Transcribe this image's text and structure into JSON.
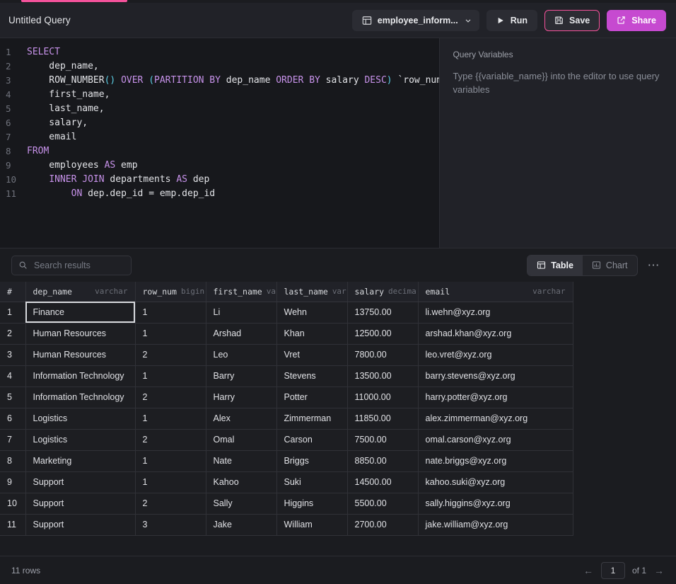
{
  "header": {
    "query_title": "Untitled Query",
    "db_selector_label": "employee_inform...",
    "db_icon": "database-table-icon",
    "chevron_icon": "chevron-down-icon",
    "run_label": "Run",
    "run_icon": "play-icon",
    "save_label": "Save",
    "save_icon": "floppy-disk-icon",
    "share_label": "Share",
    "share_icon": "external-link-icon"
  },
  "editor": {
    "lines": [
      {
        "n": "1",
        "tokens": [
          {
            "t": "SELECT",
            "c": "kw"
          }
        ]
      },
      {
        "n": "2",
        "tokens": [
          {
            "t": "    dep_name,",
            "c": "plain"
          }
        ]
      },
      {
        "n": "3",
        "tokens": [
          {
            "t": "    ROW_NUMBER",
            "c": "plain"
          },
          {
            "t": "()",
            "c": "paren-blue"
          },
          {
            "t": " ",
            "c": "plain"
          },
          {
            "t": "OVER",
            "c": "kw"
          },
          {
            "t": " ",
            "c": "plain"
          },
          {
            "t": "(",
            "c": "paren-blue"
          },
          {
            "t": "PARTITION BY",
            "c": "kw"
          },
          {
            "t": " dep_name ",
            "c": "plain"
          },
          {
            "t": "ORDER BY",
            "c": "kw"
          },
          {
            "t": " salary ",
            "c": "plain"
          },
          {
            "t": "DESC",
            "c": "kw"
          },
          {
            "t": ")",
            "c": "paren-blue"
          },
          {
            "t": " `row_num`,",
            "c": "plain"
          }
        ]
      },
      {
        "n": "4",
        "tokens": [
          {
            "t": "    first_name,",
            "c": "plain"
          }
        ]
      },
      {
        "n": "5",
        "tokens": [
          {
            "t": "    last_name,",
            "c": "plain"
          }
        ]
      },
      {
        "n": "6",
        "tokens": [
          {
            "t": "    salary,",
            "c": "plain"
          }
        ]
      },
      {
        "n": "7",
        "tokens": [
          {
            "t": "    email",
            "c": "plain"
          }
        ]
      },
      {
        "n": "8",
        "tokens": [
          {
            "t": "FROM",
            "c": "kw"
          }
        ]
      },
      {
        "n": "9",
        "tokens": [
          {
            "t": "    employees ",
            "c": "plain"
          },
          {
            "t": "AS",
            "c": "kw"
          },
          {
            "t": " emp",
            "c": "plain"
          }
        ]
      },
      {
        "n": "10",
        "tokens": [
          {
            "t": "    ",
            "c": "plain"
          },
          {
            "t": "INNER JOIN",
            "c": "kw"
          },
          {
            "t": " departments ",
            "c": "plain"
          },
          {
            "t": "AS",
            "c": "kw"
          },
          {
            "t": " dep",
            "c": "plain"
          }
        ]
      },
      {
        "n": "11",
        "tokens": [
          {
            "t": "        ",
            "c": "plain"
          },
          {
            "t": "ON",
            "c": "kw"
          },
          {
            "t": " dep.dep_id = emp.dep_id",
            "c": "plain"
          }
        ]
      }
    ]
  },
  "variables_panel": {
    "title": "Query Variables",
    "hint": "Type {{variable_name}} into the editor to use query variables"
  },
  "results_toolbar": {
    "search_placeholder": "Search results",
    "search_value": "",
    "search_icon": "search-icon",
    "table_label": "Table",
    "table_icon": "table-icon",
    "chart_label": "Chart",
    "chart_icon": "bar-chart-icon",
    "active_view": "Table",
    "more_icon": "more-horizontal-icon"
  },
  "results_table": {
    "index_header": "#",
    "columns": [
      {
        "name": "dep_name",
        "type": "varchar"
      },
      {
        "name": "row_num",
        "type": "bigin"
      },
      {
        "name": "first_name",
        "type": "va"
      },
      {
        "name": "last_name",
        "type": "var"
      },
      {
        "name": "salary",
        "type": "decima"
      },
      {
        "name": "email",
        "type": "varchar"
      }
    ],
    "selected_cell": {
      "row": 0,
      "col": 0
    },
    "rows": [
      {
        "idx": "1",
        "cells": [
          "Finance",
          "1",
          "Li",
          "Wehn",
          "13750.00",
          "li.wehn@xyz.org"
        ]
      },
      {
        "idx": "2",
        "cells": [
          "Human Resources",
          "1",
          "Arshad",
          "Khan",
          "12500.00",
          "arshad.khan@xyz.org"
        ]
      },
      {
        "idx": "3",
        "cells": [
          "Human Resources",
          "2",
          "Leo",
          "Vret",
          "7800.00",
          "leo.vret@xyz.org"
        ]
      },
      {
        "idx": "4",
        "cells": [
          "Information Technology",
          "1",
          "Barry",
          "Stevens",
          "13500.00",
          "barry.stevens@xyz.org"
        ]
      },
      {
        "idx": "5",
        "cells": [
          "Information Technology",
          "2",
          "Harry",
          "Potter",
          "11000.00",
          "harry.potter@xyz.org"
        ]
      },
      {
        "idx": "6",
        "cells": [
          "Logistics",
          "1",
          "Alex",
          "Zimmerman",
          "11850.00",
          "alex.zimmerman@xyz.org"
        ]
      },
      {
        "idx": "7",
        "cells": [
          "Logistics",
          "2",
          "Omal",
          "Carson",
          "7500.00",
          "omal.carson@xyz.org"
        ]
      },
      {
        "idx": "8",
        "cells": [
          "Marketing",
          "1",
          "Nate",
          "Briggs",
          "8850.00",
          "nate.briggs@xyz.org"
        ]
      },
      {
        "idx": "9",
        "cells": [
          "Support",
          "1",
          "Kahoo",
          "Suki",
          "14500.00",
          "kahoo.suki@xyz.org"
        ]
      },
      {
        "idx": "10",
        "cells": [
          "Support",
          "2",
          "Sally",
          "Higgins",
          "5500.00",
          "sally.higgins@xyz.org"
        ]
      },
      {
        "idx": "11",
        "cells": [
          "Support",
          "3",
          "Jake",
          "William",
          "2700.00",
          "jake.william@xyz.org"
        ]
      }
    ]
  },
  "footer": {
    "rows_count": "11 rows",
    "prev_icon": "arrow-left-icon",
    "next_icon": "arrow-right-icon",
    "page_value": "1",
    "of_label": "of 1"
  },
  "colors": {
    "accent_pink": "#f4529b",
    "share_purple": "#c64ad0",
    "editor_bg": "#17181c",
    "panel_bg": "#212228",
    "app_bg": "#1b1c20",
    "keyword": "#c792ea",
    "paren": "#5ccfe6"
  }
}
